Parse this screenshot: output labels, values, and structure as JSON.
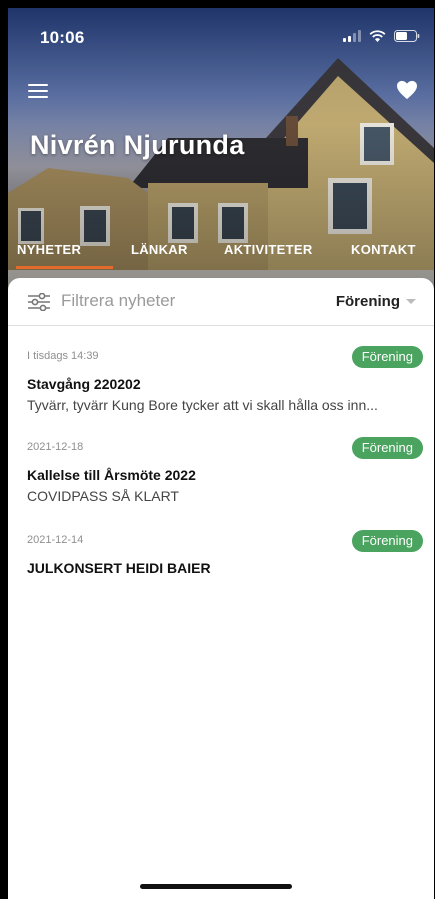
{
  "status_bar": {
    "time": "10:06"
  },
  "header": {
    "title": "Nivrén Njurunda",
    "menu_icon": "hamburger-menu-icon",
    "favorite_icon": "heart-icon"
  },
  "tabs": [
    {
      "label": "NYHETER",
      "active": true
    },
    {
      "label": "LÄNKAR",
      "active": false
    },
    {
      "label": "AKTIVITETER",
      "active": false
    },
    {
      "label": "KONTAKT",
      "active": false
    }
  ],
  "accent_color": "#e36a2a",
  "badge_color": "#4aa35e",
  "filter": {
    "placeholder": "Filtrera nyheter",
    "selected": "Förening",
    "icon": "sliders-filter-icon"
  },
  "news": [
    {
      "date": "I tisdags 14:39",
      "badge": "Förening",
      "title": "Stavgång 220202",
      "excerpt": "Tyvärr, tyvärr Kung Bore tycker att vi skall hålla oss inn..."
    },
    {
      "date": "2021-12-18",
      "badge": "Förening",
      "title": "Kallelse till Årsmöte 2022",
      "excerpt": "COVIDPASS SÅ KLART"
    },
    {
      "date": "2021-12-14",
      "badge": "Förening",
      "title": "JULKONSERT HEIDI BAIER",
      "excerpt": ""
    }
  ]
}
